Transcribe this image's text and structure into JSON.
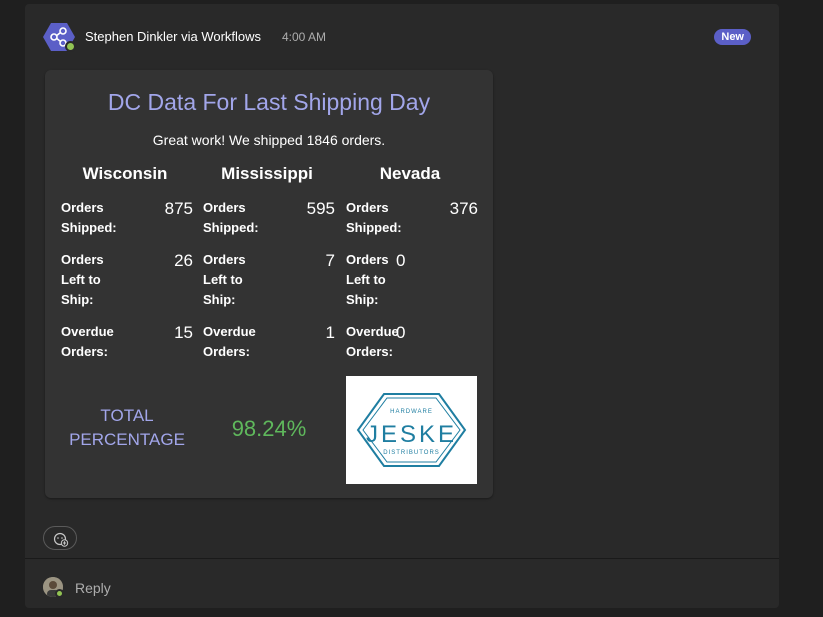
{
  "message": {
    "sender": "Stephen Dinkler via Workflows",
    "time": "4:00 AM",
    "badge": "New"
  },
  "card": {
    "title": "DC Data For Last Shipping Day",
    "subtitle": "Great work! We shipped 1846 orders.",
    "dcs": [
      {
        "name": "Wisconsin",
        "metrics": [
          {
            "label": "Orders Shipped:",
            "value": "875"
          },
          {
            "label": "Orders Left to Ship:",
            "value": "26"
          },
          {
            "label": "Overdue Orders:",
            "value": "15"
          }
        ]
      },
      {
        "name": "Mississippi",
        "metrics": [
          {
            "label": "Orders Shipped:",
            "value": "595"
          },
          {
            "label": "Orders Left to Ship:",
            "value": "7"
          },
          {
            "label": "Overdue Orders:",
            "value": "1"
          }
        ]
      },
      {
        "name": "Nevada",
        "metrics": [
          {
            "label": "Orders Shipped:",
            "value": "376"
          },
          {
            "label": "Orders Left to Ship:",
            "value": "0"
          },
          {
            "label": "Overdue Orders:",
            "value": "0"
          }
        ]
      }
    ],
    "total_label": "TOTAL PERCENTAGE",
    "total_value": "98.24%",
    "logo": {
      "name": "JESKE",
      "top_text": "HARDWARE",
      "bottom_text": "DISTRIBUTORS",
      "color": "#1f7ea1"
    }
  },
  "reply": {
    "label": "Reply"
  },
  "icons": {
    "bot_avatar": "workflows-share-icon",
    "reaction": "add-reaction-icon"
  },
  "colors": {
    "accent": "#a2a6ea",
    "success": "#5fb85c",
    "badge": "#5b5fc7",
    "presence": "#92c353"
  }
}
